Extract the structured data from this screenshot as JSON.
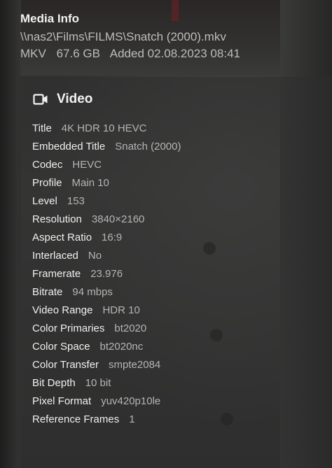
{
  "header": {
    "title": "Media Info",
    "path": "\\\\nas2\\Films\\FILMS\\Snatch (2000).mkv",
    "container": "MKV",
    "size": "67.6 GB",
    "added": "Added 02.08.2023 08:41"
  },
  "video": {
    "section_label": "Video",
    "icon": "video-camera-icon",
    "rows": [
      {
        "key": "Title",
        "value": "4K HDR 10 HEVC"
      },
      {
        "key": "Embedded Title",
        "value": "Snatch (2000)"
      },
      {
        "key": "Codec",
        "value": "HEVC"
      },
      {
        "key": "Profile",
        "value": "Main 10"
      },
      {
        "key": "Level",
        "value": "153"
      },
      {
        "key": "Resolution",
        "value": "3840×2160"
      },
      {
        "key": "Aspect Ratio",
        "value": "16:9"
      },
      {
        "key": "Interlaced",
        "value": "No"
      },
      {
        "key": "Framerate",
        "value": "23.976"
      },
      {
        "key": "Bitrate",
        "value": "94 mbps"
      },
      {
        "key": "Video Range",
        "value": "HDR 10"
      },
      {
        "key": "Color Primaries",
        "value": "bt2020"
      },
      {
        "key": "Color Space",
        "value": "bt2020nc"
      },
      {
        "key": "Color Transfer",
        "value": "smpte2084"
      },
      {
        "key": "Bit Depth",
        "value": "10 bit"
      },
      {
        "key": "Pixel Format",
        "value": "yuv420p10le"
      },
      {
        "key": "Reference Frames",
        "value": "1"
      }
    ]
  }
}
